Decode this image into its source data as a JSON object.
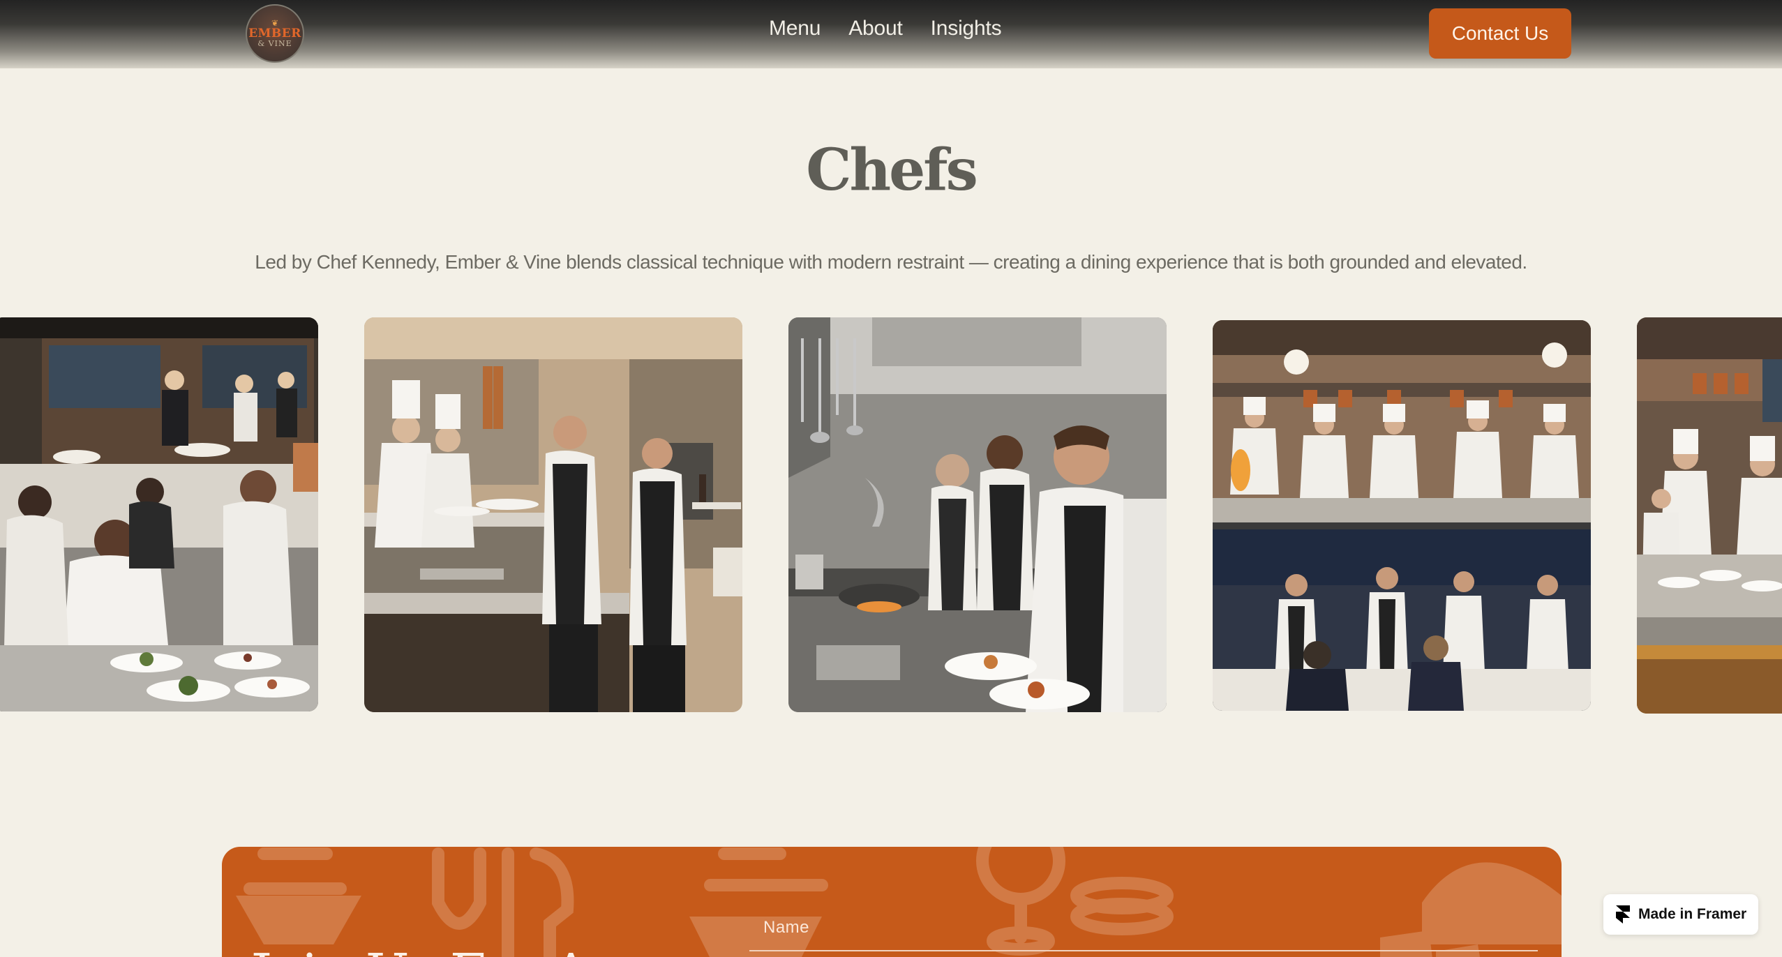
{
  "header": {
    "logo": {
      "icon": "ember-vine-logo",
      "line1": "EMBER",
      "line2": "& VINE"
    },
    "nav": [
      {
        "label": "Menu"
      },
      {
        "label": "About"
      },
      {
        "label": "Insights"
      }
    ],
    "contact_label": "Contact Us"
  },
  "section": {
    "title": "Chefs",
    "subtitle": "Led by Chef Kennedy, Ember & Vine blends classical technique with modern restraint — creating a dining experience that is both grounded and elevated."
  },
  "gallery": {
    "images": [
      {
        "name": "chefs-plating-photo"
      },
      {
        "name": "servers-at-pass-photo"
      },
      {
        "name": "chefs-cooking-photo"
      },
      {
        "name": "kitchen-and-dining-photo"
      },
      {
        "name": "kitchen-line-photo"
      }
    ]
  },
  "reservation_form": {
    "heading": "Join Us For A",
    "name_label": "Name"
  },
  "badge": {
    "label": "Made in Framer",
    "icon": "framer-icon"
  },
  "colors": {
    "background": "#f3f0e7",
    "accent": "#c5591a",
    "header_dark": "#232323",
    "text_muted": "#6c6a62"
  }
}
